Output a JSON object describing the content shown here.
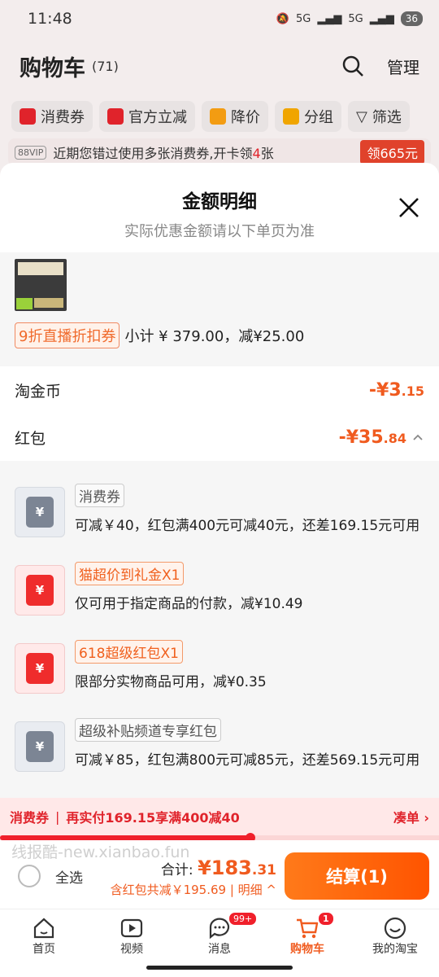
{
  "status": {
    "time": "11:48",
    "signal1": "5G",
    "signal2": "5G",
    "battery": "36"
  },
  "cart": {
    "title": "购物车",
    "count": "(71)",
    "manage": "管理",
    "chips": [
      {
        "label": "消费券",
        "color": "#e0232b"
      },
      {
        "label": "官方立减",
        "color": "#e0232b"
      },
      {
        "label": "降价",
        "color": "#f39c12"
      },
      {
        "label": "分组",
        "color": "#f0a500"
      },
      {
        "label": "筛选",
        "color": "#333333"
      }
    ],
    "vip": {
      "badge": "88VIP",
      "text_pre": "近期您错过使用多张消费券,开卡领",
      "text_num": "4",
      "text_post": "张",
      "button": "领665元"
    }
  },
  "sheet": {
    "title": "金额明细",
    "subtitle": "实际优惠金额请以下单页为准",
    "product": {
      "coupon_tag": "9折直播折扣券",
      "summary": "小计 ¥ 379.00，减¥25.00"
    },
    "taojinbi": {
      "label": "淘金币",
      "amount_main": "-¥3",
      "amount_dec": ".15"
    },
    "hongbao": {
      "label": "红包",
      "amount_main": "-¥35",
      "amount_dec": ".84"
    },
    "vouchers": [
      {
        "tag": "消费券",
        "style": "grey",
        "desc": "可减￥40，红包满400元可减40元，还差169.15元可用"
      },
      {
        "tag": "猫超价到礼金X1",
        "style": "red",
        "desc": "仅可用于指定商品的付款，减¥10.49"
      },
      {
        "tag": "618超级红包X1",
        "style": "red",
        "desc": "限部分实物商品可用，减¥0.35"
      },
      {
        "tag": "超级补贴频道专享红包",
        "style": "grey",
        "desc": "可减￥85，红包满800元可减85元，还差569.15元可用"
      }
    ]
  },
  "promo": {
    "label": "消费券",
    "text": "再实付169.15享满400减40",
    "action": "凑单",
    "progress": 0.57
  },
  "checkout": {
    "watermark": "线报酷-new.xianbao.fun",
    "select_all": "全选",
    "total_label": "合计:",
    "total_main": "¥183",
    "total_dec": ".31",
    "discount": "含红包共减￥195.69 | 明细",
    "button": "结算(1)"
  },
  "tabs": [
    {
      "label": "首页",
      "icon": "home-icon"
    },
    {
      "label": "视频",
      "icon": "video-icon"
    },
    {
      "label": "消息",
      "icon": "message-icon",
      "badge": "99+"
    },
    {
      "label": "购物车",
      "icon": "cart-icon",
      "badge": "1",
      "active": true
    },
    {
      "label": "我的淘宝",
      "icon": "profile-icon"
    }
  ],
  "colors": {
    "accent": "#f05b1f",
    "red": "#e0232b"
  }
}
